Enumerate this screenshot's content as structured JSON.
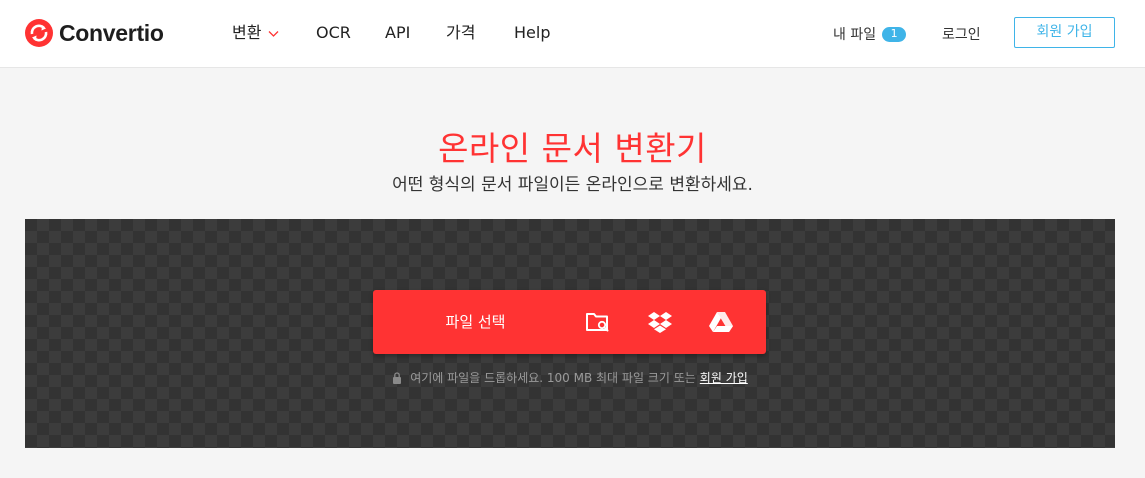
{
  "brand": {
    "name": "Convertio",
    "accent": "#ff3333",
    "link_color": "#3fb4e8"
  },
  "nav": {
    "convert": "변환",
    "ocr": "OCR",
    "api": "API",
    "pricing": "가격",
    "help": "Help"
  },
  "account": {
    "my_files": "내 파일",
    "my_files_count": "1",
    "login": "로그인",
    "signup": "회원 가입"
  },
  "hero": {
    "title": "온라인 문서 변환기",
    "subtitle": "어떤 형식의 문서 파일이든 온라인으로 변환하세요."
  },
  "dropzone": {
    "select_label": "파일 선택",
    "sources": [
      "folder-search-icon",
      "dropbox-icon",
      "google-drive-icon"
    ],
    "hint_text": "여기에 파일을 드롭하세요. 100 MB 최대 파일 크기 또는",
    "hint_link": "회원 가입"
  }
}
